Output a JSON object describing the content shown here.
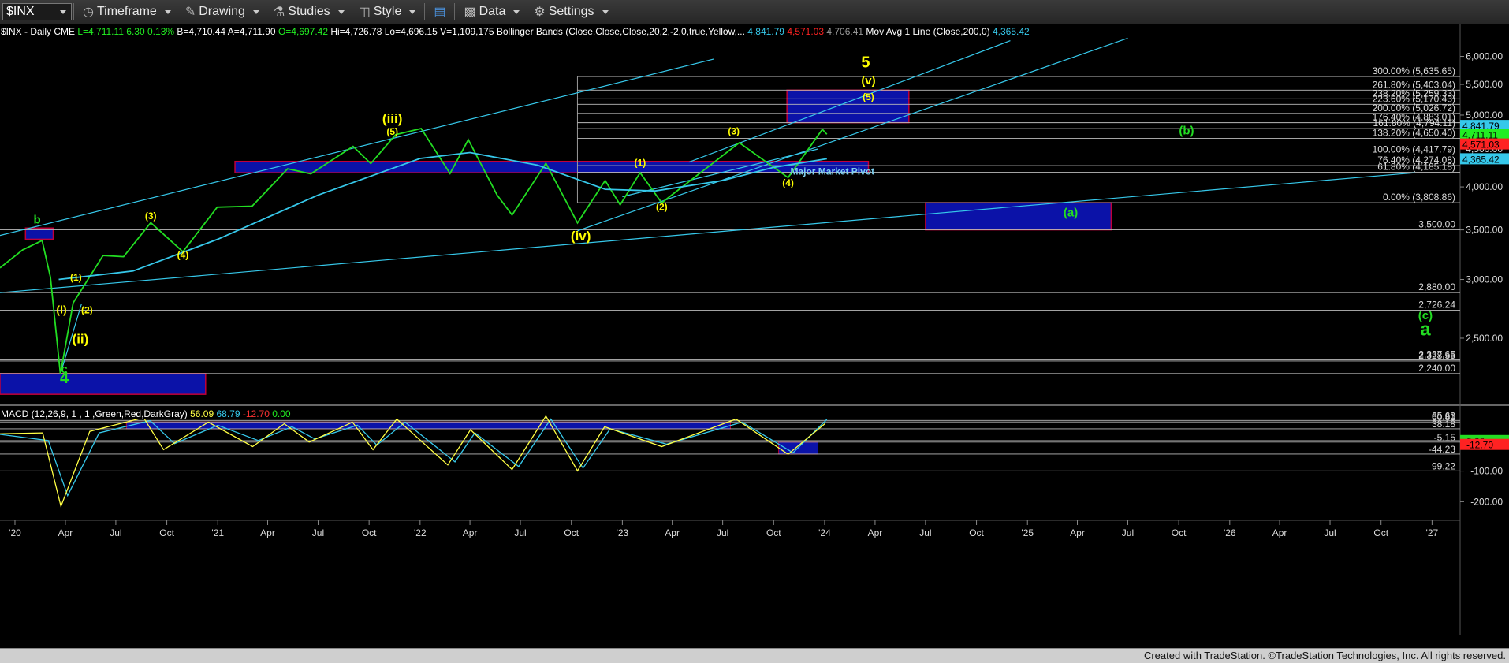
{
  "toolbar": {
    "symbol": "$INX",
    "buttons": [
      {
        "label": "Timeframe",
        "icon": "timeframe-icon"
      },
      {
        "label": "Drawing",
        "icon": "drawing-icon"
      },
      {
        "label": "Studies",
        "icon": "studies-icon"
      },
      {
        "label": "Style",
        "icon": "style-icon"
      },
      {
        "label": "",
        "icon": "layout-icon"
      },
      {
        "label": "Data",
        "icon": "data-icon"
      },
      {
        "label": "Settings",
        "icon": "settings-icon"
      }
    ]
  },
  "price_header": {
    "items": [
      {
        "text": "$INX - Daily  CME",
        "color": "#ffffff"
      },
      {
        "text": "L=4,711.11",
        "color": "#22ee22"
      },
      {
        "text": "6.30",
        "color": "#22ee22"
      },
      {
        "text": "0.13%",
        "color": "#22ee22"
      },
      {
        "text": "B=4,710.44",
        "color": "#ffffff"
      },
      {
        "text": "A=4,711.90",
        "color": "#ffffff"
      },
      {
        "text": "O=4,697.42",
        "color": "#22ee22"
      },
      {
        "text": "Hi=4,726.78",
        "color": "#ffffff"
      },
      {
        "text": "Lo=4,696.15",
        "color": "#ffffff"
      },
      {
        "text": "V=1,109,175",
        "color": "#ffffff"
      },
      {
        "text": "Bollinger Bands (Close,Close,Close,20,2,-2,0,true,Yellow,...",
        "color": "#ffffff"
      },
      {
        "text": "4,841.79",
        "color": "#36c8ea"
      },
      {
        "text": "4,571.03",
        "color": "#ff2222"
      },
      {
        "text": "4,706.41",
        "color": "#9a9a9a"
      },
      {
        "text": "Mov Avg 1 Line (Close,200,0)",
        "color": "#ffffff"
      },
      {
        "text": "4,365.42",
        "color": "#36c8ea"
      }
    ]
  },
  "macd_header": {
    "items": [
      {
        "text": "MACD (12,26,9, 1 , 1 ,Green,Red,DarkGray)",
        "color": "#ffffff"
      },
      {
        "text": "56.09",
        "color": "#ffff44"
      },
      {
        "text": "68.79",
        "color": "#36c8ea"
      },
      {
        "text": "-12.70",
        "color": "#ff3333"
      },
      {
        "text": "0.00",
        "color": "#22ee22"
      }
    ]
  },
  "chart_data": {
    "type": "line",
    "price_axis": {
      "scale": "log",
      "range": [
        2050,
        6450
      ],
      "ticks": [
        "6,000.00",
        "5,500.00",
        "5,000.00",
        "4,500.00",
        "4,000.00",
        "3,500.00",
        "3,000.00",
        "2,500.00"
      ]
    },
    "macd_axis": {
      "range": [
        -230,
        100
      ],
      "ticks": [
        "-100.00",
        "-200.00"
      ]
    },
    "time_axis": {
      "range": [
        "2019-12-05",
        "2027-02-15"
      ],
      "ticks": [
        [
          "2020-01-01",
          "'20"
        ],
        [
          "2020-04-01",
          "Apr"
        ],
        [
          "2020-07-01",
          "Jul"
        ],
        [
          "2020-10-01",
          "Oct"
        ],
        [
          "2021-01-01",
          "'21"
        ],
        [
          "2021-04-01",
          "Apr"
        ],
        [
          "2021-07-01",
          "Jul"
        ],
        [
          "2021-10-01",
          "Oct"
        ],
        [
          "2022-01-01",
          "'22"
        ],
        [
          "2022-04-01",
          "Apr"
        ],
        [
          "2022-07-01",
          "Jul"
        ],
        [
          "2022-10-01",
          "Oct"
        ],
        [
          "2023-01-01",
          "'23"
        ],
        [
          "2023-04-01",
          "Apr"
        ],
        [
          "2023-07-01",
          "Jul"
        ],
        [
          "2023-10-01",
          "Oct"
        ],
        [
          "2024-01-01",
          "'24"
        ],
        [
          "2024-04-01",
          "Apr"
        ],
        [
          "2024-07-01",
          "Jul"
        ],
        [
          "2024-10-01",
          "Oct"
        ],
        [
          "2025-01-01",
          "'25"
        ],
        [
          "2025-04-01",
          "Apr"
        ],
        [
          "2025-07-01",
          "Jul"
        ],
        [
          "2025-10-01",
          "Oct"
        ],
        [
          "2026-01-01",
          "'26"
        ],
        [
          "2026-04-01",
          "Apr"
        ],
        [
          "2026-07-01",
          "Jul"
        ],
        [
          "2026-10-01",
          "Oct"
        ],
        [
          "2027-01-01",
          "'27"
        ]
      ]
    },
    "series": [
      {
        "name": "$INX",
        "color": "#22dd22",
        "points": [
          [
            "2019-12-05",
            3110
          ],
          [
            "2020-01-15",
            3290
          ],
          [
            "2020-02-19",
            3386
          ],
          [
            "2020-03-05",
            3020
          ],
          [
            "2020-03-23",
            2237
          ],
          [
            "2020-04-15",
            2790
          ],
          [
            "2020-06-08",
            3232
          ],
          [
            "2020-07-15",
            3220
          ],
          [
            "2020-09-02",
            3580
          ],
          [
            "2020-10-30",
            3270
          ],
          [
            "2020-12-31",
            3756
          ],
          [
            "2021-03-04",
            3768
          ],
          [
            "2021-05-07",
            4232
          ],
          [
            "2021-06-18",
            4166
          ],
          [
            "2021-09-02",
            4537
          ],
          [
            "2021-10-04",
            4300
          ],
          [
            "2021-11-18",
            4705
          ],
          [
            "2022-01-03",
            4796
          ],
          [
            "2022-02-24",
            4170
          ],
          [
            "2022-03-29",
            4632
          ],
          [
            "2022-05-20",
            3900
          ],
          [
            "2022-06-16",
            3666
          ],
          [
            "2022-08-16",
            4305
          ],
          [
            "2022-10-12",
            3577
          ],
          [
            "2022-12-01",
            4080
          ],
          [
            "2022-12-28",
            3783
          ],
          [
            "2023-02-02",
            4180
          ],
          [
            "2023-03-13",
            3808
          ],
          [
            "2023-07-31",
            4589
          ],
          [
            "2023-10-27",
            4117
          ],
          [
            "2023-12-28",
            4783
          ],
          [
            "2024-01-05",
            4711
          ]
        ]
      },
      {
        "name": "Mov Avg 1 Line",
        "color": "#36c8ea",
        "points": [
          [
            "2020-03-20",
            3000
          ],
          [
            "2020-08-01",
            3080
          ],
          [
            "2021-01-01",
            3400
          ],
          [
            "2021-07-01",
            3900
          ],
          [
            "2022-01-01",
            4370
          ],
          [
            "2022-04-01",
            4450
          ],
          [
            "2022-08-01",
            4280
          ],
          [
            "2022-12-01",
            3970
          ],
          [
            "2023-03-01",
            3950
          ],
          [
            "2023-07-01",
            4080
          ],
          [
            "2023-10-01",
            4250
          ],
          [
            "2024-01-05",
            4365
          ]
        ]
      }
    ],
    "fib_levels": [
      {
        "label": "300.00% (5,635.65)",
        "value": 5635.65
      },
      {
        "label": "261.80% (5,403.04)",
        "value": 5403.04
      },
      {
        "label": "238.20% (5,259.33)",
        "value": 5259.33
      },
      {
        "label": "223.60% (5,170.43)",
        "value": 5170.43
      },
      {
        "label": "200.00% (5,026.72)",
        "value": 5026.72
      },
      {
        "label": "176.40% (4,883.01)",
        "value": 4883.01
      },
      {
        "label": "161.80% (4,794.11)",
        "value": 4794.11
      },
      {
        "label": "138.20% (4,650.40)",
        "value": 4650.4
      },
      {
        "label": "100.00% (4,417.79)",
        "value": 4417.79
      },
      {
        "label": "76.40% (4,274.08)",
        "value": 4274.08
      },
      {
        "label": "61.80% (4,185.18)",
        "value": 4185.18
      },
      {
        "label": "0.00% (3,808.86)",
        "value": 3808.86
      }
    ],
    "level_lines": [
      {
        "label": "3,500.00",
        "value": 3500
      },
      {
        "label": "2,880.00",
        "value": 2880
      },
      {
        "label": "2,726.24",
        "value": 2726.24
      },
      {
        "label": "2,337.65",
        "value": 2337.65
      },
      {
        "label": "2,328.55",
        "value": 2328.55
      },
      {
        "label": "2,240.00",
        "value": 2240
      }
    ],
    "price_tags": [
      {
        "text": "4,841.79",
        "value": 4841.79,
        "bg": "#36c8ea"
      },
      {
        "text": "4,711.11",
        "value": 4711.11,
        "bg": "#22ee22"
      },
      {
        "text": "4,571.03",
        "value": 4571.03,
        "bg": "#ff2222"
      },
      {
        "text": "4,365.42",
        "value": 4365.42,
        "bg": "#36c8ea"
      }
    ],
    "zones": [
      {
        "t0": "2023-10-25",
        "t1": "2024-06-01",
        "p0": 4883,
        "p1": 5403
      },
      {
        "t0": "2024-07-01",
        "t1": "2025-06-01",
        "p0": 3500,
        "p1": 3808
      },
      {
        "t0": "2021-02-01",
        "t1": "2024-03-20",
        "p0": 4180,
        "p1": 4330
      },
      {
        "t0": "2019-12-05",
        "t1": "2020-12-10",
        "p0": 2100,
        "p1": 2240
      },
      {
        "t0": "2020-01-20",
        "t1": "2020-03-10",
        "p0": 3400,
        "p1": 3520
      }
    ],
    "annotations": [
      {
        "text": "5",
        "t": "2024-03-15",
        "p": 5800,
        "color": "#ffff00",
        "size": 20
      },
      {
        "text": "(v)",
        "t": "2024-03-20",
        "p": 5500,
        "color": "#ffff00",
        "size": 15
      },
      {
        "text": "(5)",
        "t": "2024-03-20",
        "p": 5240,
        "color": "#ffff00",
        "size": 12
      },
      {
        "text": "(iii)",
        "t": "2021-11-12",
        "p": 4880,
        "color": "#ffff00",
        "size": 17
      },
      {
        "text": "(5)",
        "t": "2021-11-12",
        "p": 4700,
        "color": "#ffff00",
        "size": 12
      },
      {
        "text": "(iv)",
        "t": "2022-10-18",
        "p": 3385,
        "color": "#ffff00",
        "size": 17
      },
      {
        "text": "(3)",
        "t": "2023-07-21",
        "p": 4710,
        "color": "#ffff00",
        "size": 12
      },
      {
        "text": "(1)",
        "t": "2023-02-02",
        "p": 4270,
        "color": "#ffff00",
        "size": 12
      },
      {
        "text": "(2)",
        "t": "2023-03-13",
        "p": 3720,
        "color": "#ffff00",
        "size": 12
      },
      {
        "text": "(4)",
        "t": "2023-10-27",
        "p": 4010,
        "color": "#ffff00",
        "size": 12
      },
      {
        "text": "(3)",
        "t": "2020-09-02",
        "p": 3620,
        "color": "#ffff00",
        "size": 12
      },
      {
        "text": "(4)",
        "t": "2020-10-30",
        "p": 3205,
        "color": "#ffff00",
        "size": 12
      },
      {
        "text": "(1)",
        "t": "2020-04-20",
        "p": 2990,
        "color": "#ffff00",
        "size": 12
      },
      {
        "text": "(i)",
        "t": "2020-03-25",
        "p": 2700,
        "color": "#ffff00",
        "size": 14
      },
      {
        "text": "(2)",
        "t": "2020-05-10",
        "p": 2700,
        "color": "#ffff00",
        "size": 12
      },
      {
        "text": "(ii)",
        "t": "2020-04-28",
        "p": 2460,
        "color": "#ffff00",
        "size": 17
      },
      {
        "text": "b",
        "t": "2020-02-10",
        "p": 3570,
        "color": "#22dd22",
        "size": 15
      },
      {
        "text": "c",
        "t": "2020-03-30",
        "p": 2245,
        "color": "#22dd22",
        "size": 15
      },
      {
        "text": "4",
        "t": "2020-03-30",
        "p": 2175,
        "color": "#22dd22",
        "size": 20
      },
      {
        "text": "(b)",
        "t": "2025-10-15",
        "p": 4710,
        "color": "#22dd22",
        "size": 15
      },
      {
        "text": "(a)",
        "t": "2025-03-20",
        "p": 3650,
        "color": "#22dd22",
        "size": 15
      },
      {
        "text": "(c)",
        "t": "2026-12-20",
        "p": 2650,
        "color": "#22dd22",
        "size": 15
      },
      {
        "text": "a",
        "t": "2026-12-20",
        "p": 2520,
        "color": "#22dd22",
        "size": 24
      },
      {
        "text": "Major Market Pivot",
        "t": "2024-01-15",
        "p": 4155,
        "color": "#7fd0f0",
        "size": 12
      }
    ],
    "macd_levels": [
      {
        "label": "65.63",
        "value": 65.63
      },
      {
        "label": "60.81",
        "value": 60.81
      },
      {
        "label": "38.18",
        "value": 38.18
      },
      {
        "label": "-5.15",
        "value": -5.15
      },
      {
        "label": "-44.23",
        "value": -44.23
      },
      {
        "label": "-99.22",
        "value": -99.22
      }
    ],
    "macd_tags": [
      {
        "text": "0.00",
        "value": 0,
        "bg": "#22dd22"
      },
      {
        "text": "-12.70",
        "value": -12.7,
        "bg": "#ff2222"
      }
    ],
    "macd_series": {
      "name": "MACD",
      "color": "#ffff44",
      "points": [
        [
          "2019-12-05",
          22
        ],
        [
          "2020-02-20",
          25
        ],
        [
          "2020-03-24",
          -215
        ],
        [
          "2020-05-15",
          30
        ],
        [
          "2020-08-20",
          75
        ],
        [
          "2020-09-25",
          -30
        ],
        [
          "2020-12-15",
          60
        ],
        [
          "2021-03-05",
          -20
        ],
        [
          "2021-05-01",
          55
        ],
        [
          "2021-06-15",
          -5
        ],
        [
          "2021-09-01",
          60
        ],
        [
          "2021-10-08",
          -30
        ],
        [
          "2021-11-20",
          70
        ],
        [
          "2022-02-20",
          -80
        ],
        [
          "2022-04-02",
          35
        ],
        [
          "2022-06-16",
          -95
        ],
        [
          "2022-08-16",
          80
        ],
        [
          "2022-10-12",
          -99
        ],
        [
          "2022-11-30",
          45
        ],
        [
          "2023-03-13",
          -20
        ],
        [
          "2023-07-25",
          70
        ],
        [
          "2023-10-27",
          -45
        ],
        [
          "2024-01-02",
          56
        ]
      ]
    },
    "macd_signal": {
      "name": "Signal",
      "color": "#36c8ea",
      "points": [
        [
          "2019-12-05",
          20
        ],
        [
          "2020-03-01",
          0
        ],
        [
          "2020-04-05",
          -180
        ],
        [
          "2020-06-01",
          25
        ],
        [
          "2020-09-01",
          65
        ],
        [
          "2020-10-15",
          -10
        ],
        [
          "2021-01-01",
          50
        ],
        [
          "2021-03-15",
          0
        ],
        [
          "2021-05-15",
          45
        ],
        [
          "2021-06-25",
          5
        ],
        [
          "2021-09-10",
          50
        ],
        [
          "2021-10-15",
          -15
        ],
        [
          "2021-12-05",
          60
        ],
        [
          "2022-03-05",
          -70
        ],
        [
          "2022-04-10",
          25
        ],
        [
          "2022-06-28",
          -85
        ],
        [
          "2022-08-25",
          70
        ],
        [
          "2022-10-22",
          -90
        ],
        [
          "2022-12-10",
          38
        ],
        [
          "2023-03-22",
          -12
        ],
        [
          "2023-08-05",
          60
        ],
        [
          "2023-11-05",
          -40
        ],
        [
          "2024-01-05",
          69
        ]
      ]
    }
  },
  "footer": {
    "text": "Created with TradeStation. ©TradeStation Technologies, Inc. All rights reserved."
  }
}
